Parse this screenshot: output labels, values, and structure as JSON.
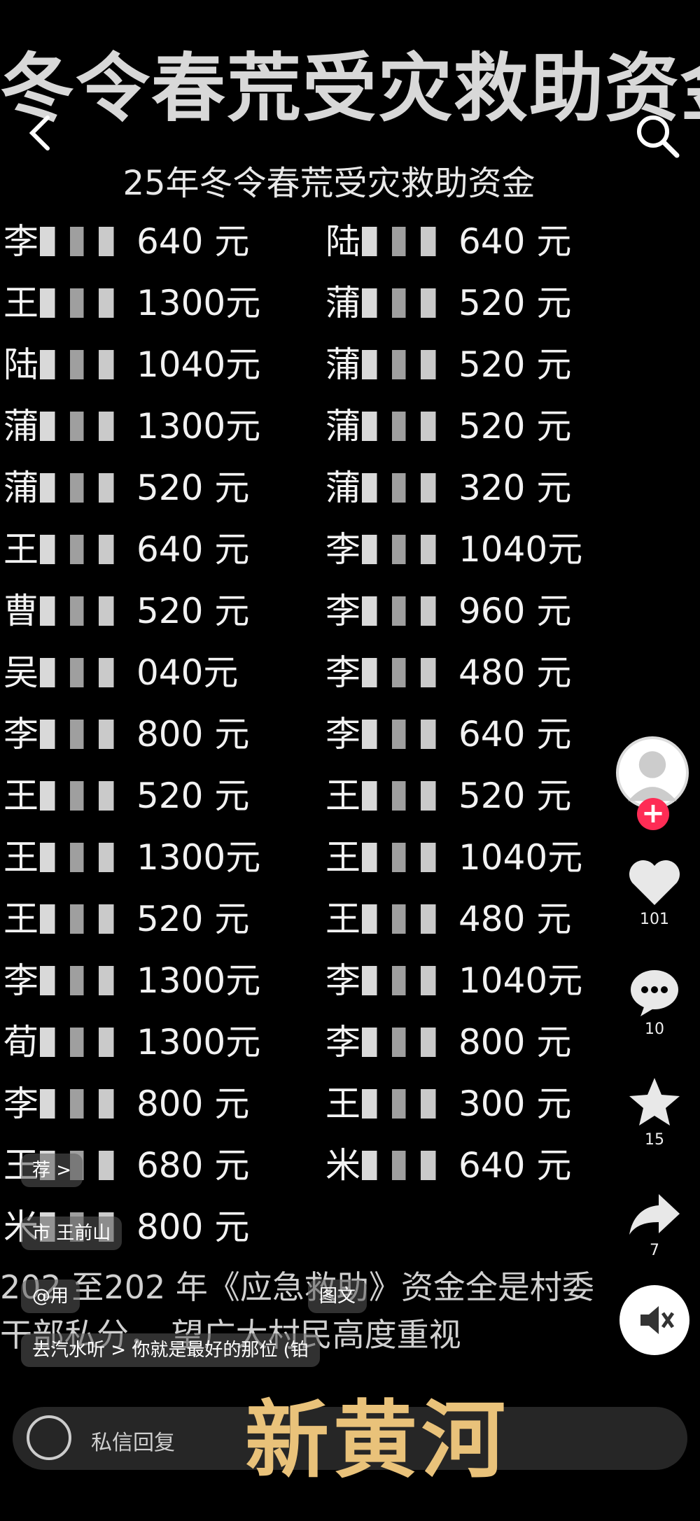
{
  "headline": "冬令春荒受灾救助资金",
  "subtitle": "25年冬令春荒受灾救助资金",
  "left_rows": [
    {
      "name": "李",
      "amount": "640 元"
    },
    {
      "name": "王",
      "amount": "1300元"
    },
    {
      "name": "陆",
      "amount": "1040元"
    },
    {
      "name": "蒲",
      "amount": "1300元"
    },
    {
      "name": "蒲",
      "amount": "520 元"
    },
    {
      "name": "王",
      "amount": "640 元"
    },
    {
      "name": "曹",
      "amount": "520 元"
    },
    {
      "name": "吴",
      "amount": "040元"
    },
    {
      "name": "李",
      "amount": "800 元"
    },
    {
      "name": "王",
      "amount": "520 元"
    },
    {
      "name": "王",
      "amount": "1300元"
    },
    {
      "name": "王",
      "amount": "520 元"
    },
    {
      "name": "李",
      "amount": "1300元"
    },
    {
      "name": "荀",
      "amount": "1300元"
    },
    {
      "name": "李",
      "amount": "800 元"
    },
    {
      "name": "王",
      "amount": "680 元"
    },
    {
      "name": "米",
      "amount": "800 元"
    }
  ],
  "right_rows": [
    {
      "name": "陆",
      "amount": "640 元"
    },
    {
      "name": "蒲",
      "amount": "520 元"
    },
    {
      "name": "蒲",
      "amount": "520 元"
    },
    {
      "name": "蒲",
      "amount": "520 元"
    },
    {
      "name": "蒲",
      "amount": "320 元"
    },
    {
      "name": "李",
      "amount": "1040元"
    },
    {
      "name": "李",
      "amount": "960 元"
    },
    {
      "name": "李",
      "amount": "480 元"
    },
    {
      "name": "李",
      "amount": "640 元"
    },
    {
      "name": "王",
      "amount": "520 元"
    },
    {
      "name": "王",
      "amount": "1040元"
    },
    {
      "name": "王",
      "amount": "480 元"
    },
    {
      "name": "李",
      "amount": "1040元"
    },
    {
      "name": "李",
      "amount": "800 元"
    },
    {
      "name": "王",
      "amount": "300 元"
    },
    {
      "name": "米",
      "amount": "640 元"
    }
  ],
  "side": {
    "like_count": "101",
    "comment_count": "10",
    "favorite_count": "15",
    "share_count": "7"
  },
  "caption_line1": "202  至202  年《应急救助》资金全是村委",
  "caption_line2": "干部私分，   望广大村民高度重视",
  "chips": {
    "recommend": "荐 >",
    "location": "市    王前山",
    "user": "@用",
    "graphic": "图文",
    "music": "去汽水听 >  你就是最好的那位  (铂"
  },
  "reply_text": "私信回复",
  "watermark": "新黄河"
}
